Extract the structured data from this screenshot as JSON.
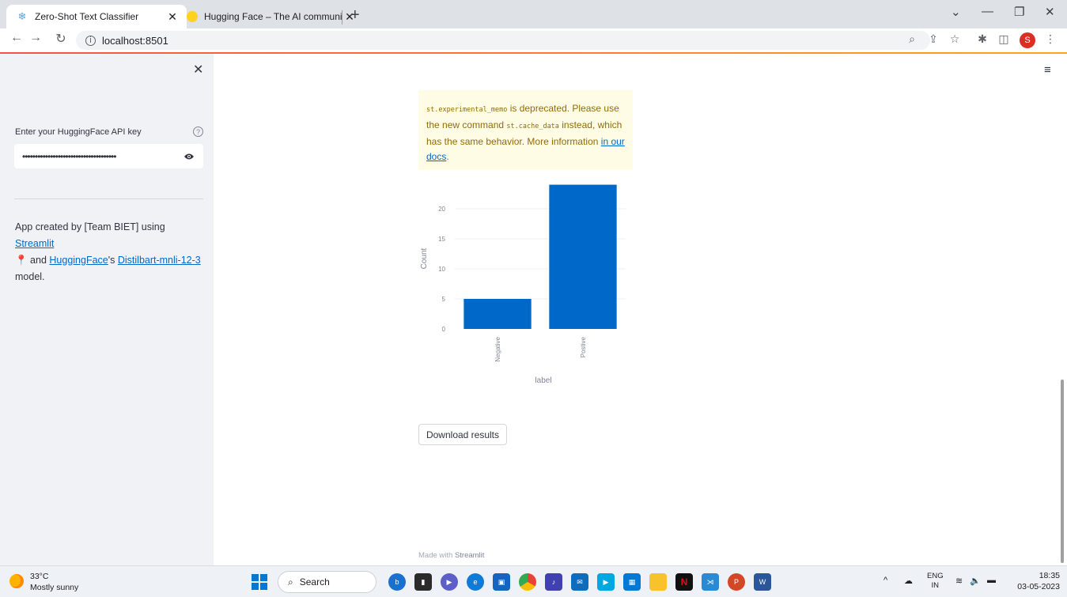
{
  "browser": {
    "tabs": [
      {
        "title": "Zero-Shot Text Classifier",
        "close": "✕"
      },
      {
        "title": "Hugging Face – The AI communi",
        "close": "✕"
      }
    ],
    "new_tab": "+",
    "url": "localhost:8501"
  },
  "sidebar": {
    "close": "✕",
    "api_key_label": "Enter your HuggingFace API key",
    "api_key_value": "•••••••••••••••••••••••••••••••••••••",
    "about": {
      "prefix": "App created by [Team BIET] using ",
      "streamlit_link": "Streamlit",
      "middle": " and ",
      "hf_link": "HuggingFace",
      "apostrophe": "'s ",
      "model_link": "Distilbart-mnli-12-3",
      "suffix": " model."
    }
  },
  "warning": {
    "code1": "st.experimental_memo",
    "text1": " is deprecated. Please use the new command ",
    "code2": "st.cache_data",
    "text2": " instead, which has the same behavior. More information ",
    "link": "in our docs",
    "text3": "."
  },
  "chart_data": {
    "type": "bar",
    "categories": [
      "Negative",
      "Postive"
    ],
    "values": [
      5,
      24
    ],
    "xlabel": "label",
    "ylabel": "Count",
    "yticks": [
      0,
      5,
      10,
      15,
      20
    ],
    "ylim": [
      0,
      25
    ],
    "bar_color": "#0068c9"
  },
  "download_button": "Download results",
  "footer": {
    "prefix": "Made with ",
    "brand": "Streamlit"
  },
  "taskbar": {
    "weather_temp": "33°C",
    "weather_desc": "Mostly sunny",
    "search": "Search",
    "lang_top": "ENG",
    "lang_bottom": "IN",
    "time": "18:35",
    "date": "03-05-2023"
  }
}
